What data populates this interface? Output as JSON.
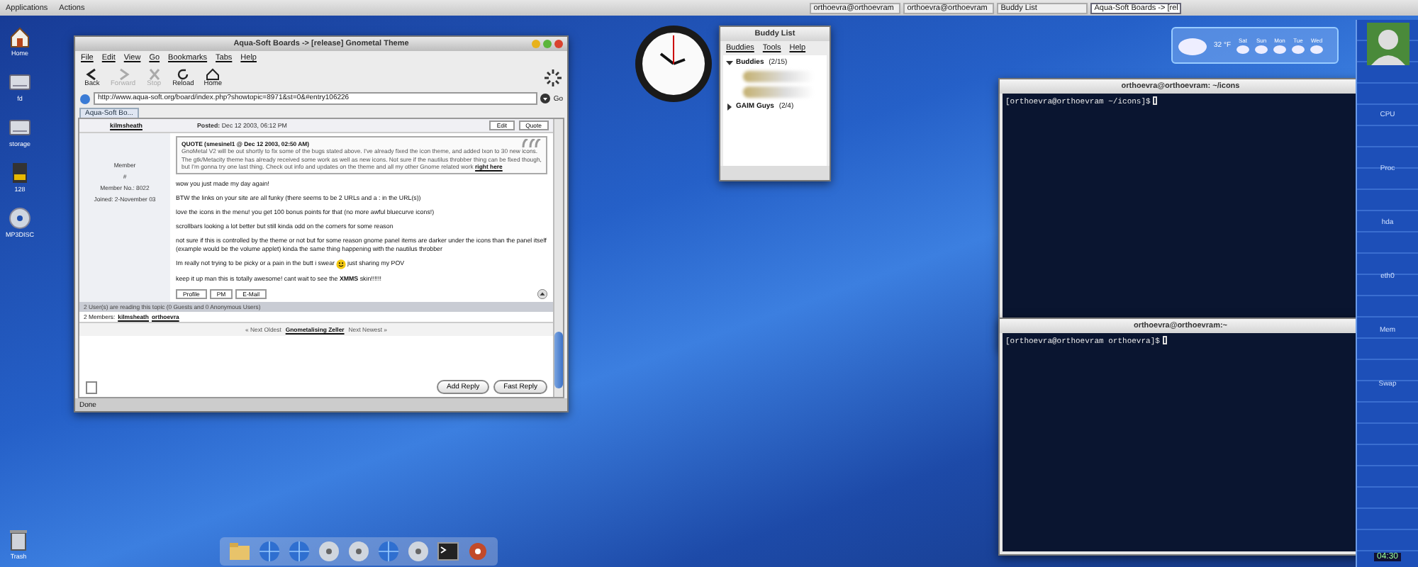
{
  "top_panel": {
    "menus": [
      "Applications",
      "Actions"
    ],
    "tasks": [
      {
        "label": "orthoevra@orthoevram",
        "selected": false
      },
      {
        "label": "orthoevra@orthoevram",
        "selected": false
      },
      {
        "label": "Buddy List",
        "selected": false
      },
      {
        "label": "Aqua-Soft Boards -> [rel",
        "selected": true
      }
    ]
  },
  "desktop_icons": [
    {
      "label": "Home",
      "kind": "home"
    },
    {
      "label": "fd",
      "kind": "drive"
    },
    {
      "label": "storage",
      "kind": "drive"
    },
    {
      "label": "128",
      "kind": "card"
    },
    {
      "label": "MP3DISC",
      "kind": "disc"
    }
  ],
  "trash": {
    "label": "Trash"
  },
  "browser": {
    "title": "Aqua-Soft Boards -> [release] Gnometal Theme",
    "menus": [
      "File",
      "Edit",
      "View",
      "Go",
      "Bookmarks",
      "Tabs",
      "Help"
    ],
    "toolbar": [
      {
        "label": "Back",
        "kind": "back",
        "disabled": false
      },
      {
        "label": "Forward",
        "kind": "forward",
        "disabled": true
      },
      {
        "label": "Stop",
        "kind": "stop",
        "disabled": true
      },
      {
        "label": "Reload",
        "kind": "reload",
        "disabled": false
      },
      {
        "label": "Home",
        "kind": "home",
        "disabled": false
      }
    ],
    "url": "http://www.aqua-soft.org/board/index.php?showtopic=8971&st=0&#entry106226",
    "go": "Go",
    "tab": "Aqua-Soft Bo...",
    "post": {
      "author": "kilmsheath",
      "posted_label": "Posted:",
      "posted": "Dec 12 2003, 06:12 PM",
      "actions": [
        "Edit",
        "Quote"
      ],
      "member": [
        "Member",
        "#",
        "Member No.: 8022",
        "Joined: 2-November 03"
      ],
      "quote_header": "QUOTE (smesinel1 @ Dec 12 2003, 02:50 AM)",
      "quote": "GnoMetal V2 will be out shortly to fix some of the bugs stated above. I've already fixed the icon theme, and added Ixon to 30 new icons. The gtk/Metacity theme has already received some work as well as new icons. Not sure if the nautilus throbber thing can be fixed though, but I'm gonna try one last thing. Check out info and updates on the theme and all my other Gnome related work",
      "quote_link": "right here",
      "lines": [
        {
          "text": "wow you just made my day again!",
          "smiley": false
        },
        {
          "text": "BTW the links on your site are all funky (there seems to be 2 URLs and a : in the URL(s))",
          "smiley": false
        },
        {
          "text": "love the icons in the menu! you get 100 bonus points for that (no more awful bluecurve icons!)",
          "smiley": false
        },
        {
          "text": "scrollbars looking a lot better but still kinda odd on the corners for some reason",
          "smiley": false
        },
        {
          "text": "not sure if this is controlled by the theme or not but for some reason gnome panel items are darker under the icons than the panel itself (example would be the volume applet) kinda the same thing happening with the nautilus throbber",
          "smiley": false
        },
        {
          "text": "Im really not trying to be picky or a pain in the butt i swear",
          "smiley": true,
          "after": "just sharing my POV"
        },
        {
          "text": "keep it up man this is totally awesome! cant wait to see the **XMMS** skin!!!!!!",
          "smiley": false
        }
      ],
      "profile_buttons": [
        "Profile",
        "PM",
        "E-Mail"
      ],
      "readers": "2 User(s) are reading this topic (0 Guests and 0 Anonymous Users)",
      "members_label": "2 Members:",
      "members": [
        "kilmsheath",
        "orthoevra"
      ],
      "nav": [
        "« Next Oldest",
        "Gnometalising Zeller",
        "Next Newest »"
      ],
      "reply_buttons": [
        "Add Reply",
        "Fast Reply"
      ]
    },
    "status": "Done"
  },
  "buddy_list": {
    "title": "Buddy List",
    "menus": [
      "Buddies",
      "Tools",
      "Help"
    ],
    "groups": [
      {
        "name": "Buddies",
        "count": "(2/15)",
        "expanded": true
      },
      {
        "name": "GAIM Guys",
        "count": "(2/4)",
        "expanded": false
      }
    ]
  },
  "weather": {
    "temp": "32 °F",
    "days": [
      "Sat",
      "Sun",
      "Mon",
      "Tue",
      "Wed"
    ]
  },
  "terminals": [
    {
      "title": "orthoevra@orthoevram: ~/icons",
      "prompt": "[orthoevra@orthoevram ~/icons]$"
    },
    {
      "title": "orthoevra@orthoevram:~",
      "prompt": "[orthoevra@orthoevram orthoevra]$"
    }
  ],
  "monitor": {
    "labels": [
      "CPU",
      "Proc",
      "hda",
      "eth0",
      "Mem",
      "Swap"
    ],
    "time": "04:30"
  },
  "dock": {
    "icons": [
      {
        "kind": "folder"
      },
      {
        "kind": "globe"
      },
      {
        "kind": "globe"
      },
      {
        "kind": "disc"
      },
      {
        "kind": "disc"
      },
      {
        "kind": "globe"
      },
      {
        "kind": "disc"
      },
      {
        "kind": "terminal"
      },
      {
        "kind": "gear"
      }
    ]
  }
}
